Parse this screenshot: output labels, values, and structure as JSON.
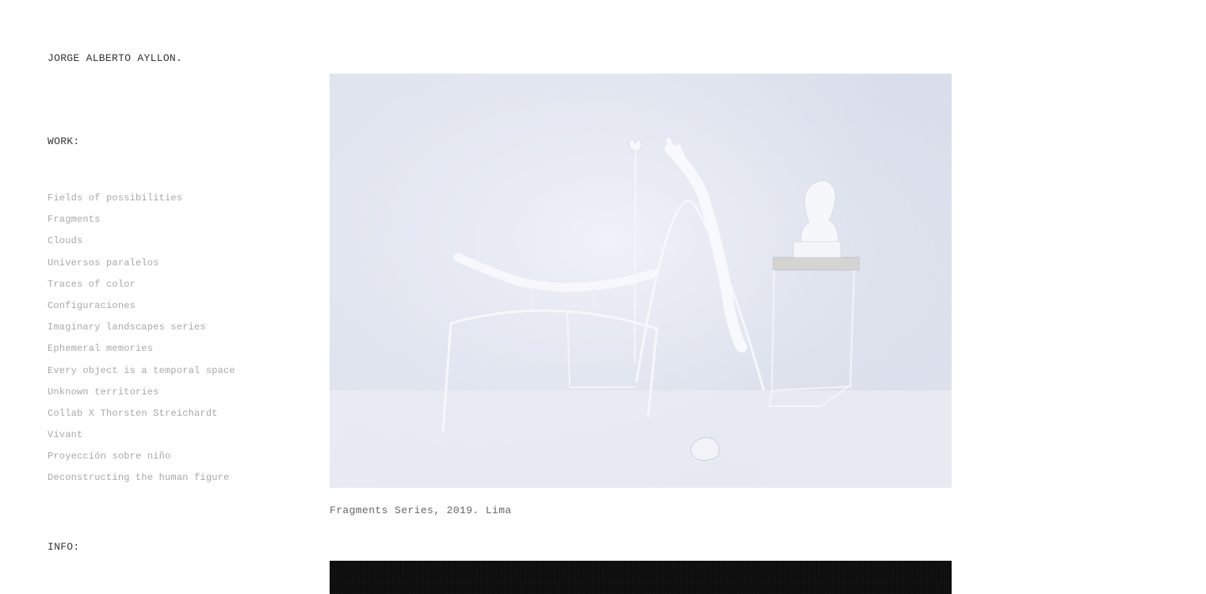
{
  "site": {
    "title": "JORGE ALBERTO AYLLON."
  },
  "sidebar": {
    "work_heading": "WORK:",
    "info_heading": "INFO:",
    "items": [
      "Fields of possibilities",
      "Fragments",
      "Clouds",
      "Universos paralelos",
      "Traces of color",
      "Configuraciones",
      "Imaginary landscapes series",
      "Ephemeral memories",
      "Every object is a temporal space",
      "Unknown territories",
      "Collab X Thorsten Streichardt",
      "Vivant",
      "Proyección sobre niño",
      "Deconstructing the human figure"
    ]
  },
  "main": {
    "caption": "Fragments Series, 2019. Lima"
  },
  "colors": {
    "background": "#ffffff",
    "text_dark": "#333333",
    "text_muted": "#a8a8a8",
    "photo_bg": "#e3e7f1"
  }
}
